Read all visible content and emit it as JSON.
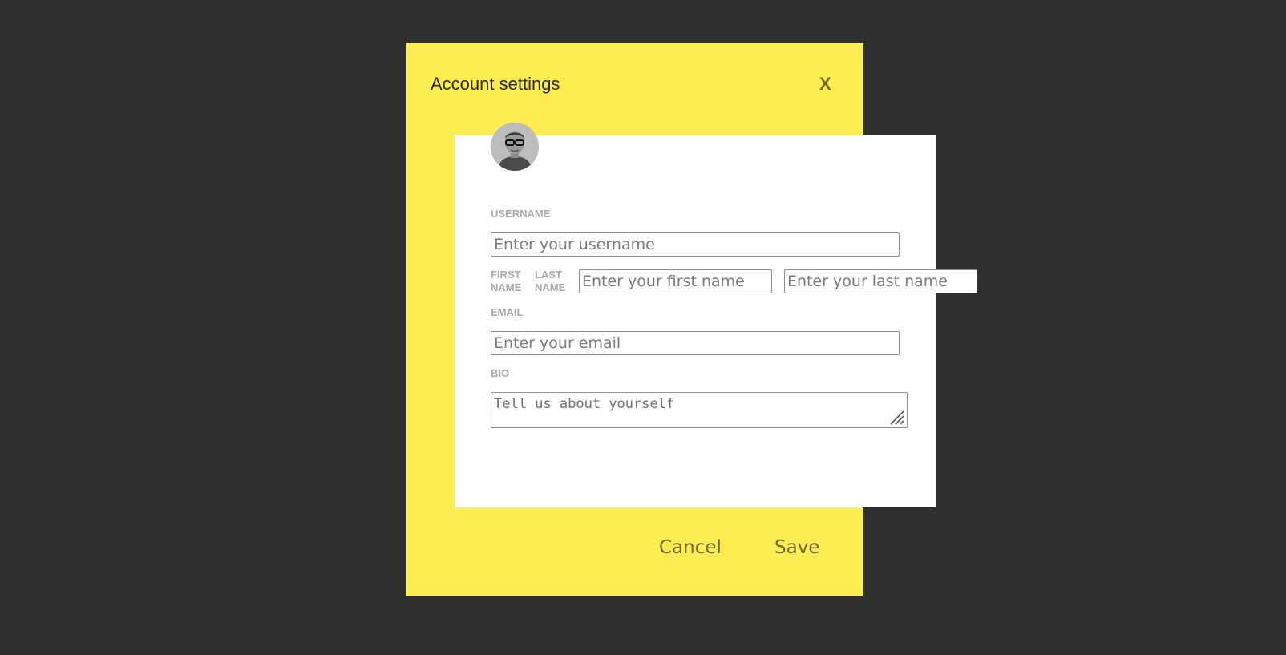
{
  "modal": {
    "title": "Account settings",
    "close_label": "X"
  },
  "avatar": {
    "icon": "user-avatar-photo"
  },
  "form": {
    "username": {
      "label": "USERNAME",
      "placeholder": "Enter your username"
    },
    "first_name": {
      "label_line1": "FIRST",
      "label_line2": "NAME",
      "placeholder": "Enter your first name"
    },
    "last_name": {
      "label_line1": "LAST",
      "label_line2": "NAME",
      "placeholder": "Enter your last name"
    },
    "email": {
      "label": "EMAIL",
      "placeholder": "Enter your email"
    },
    "bio": {
      "label": "BIO",
      "placeholder": "Tell us about yourself"
    }
  },
  "footer": {
    "cancel_label": "Cancel",
    "save_label": "Save"
  },
  "colors": {
    "backdrop": "#2f2f2f",
    "modal_bg": "#feed52",
    "card_bg": "#ffffff",
    "accent_text": "#6f6a24",
    "label": "#a9a9a9"
  }
}
